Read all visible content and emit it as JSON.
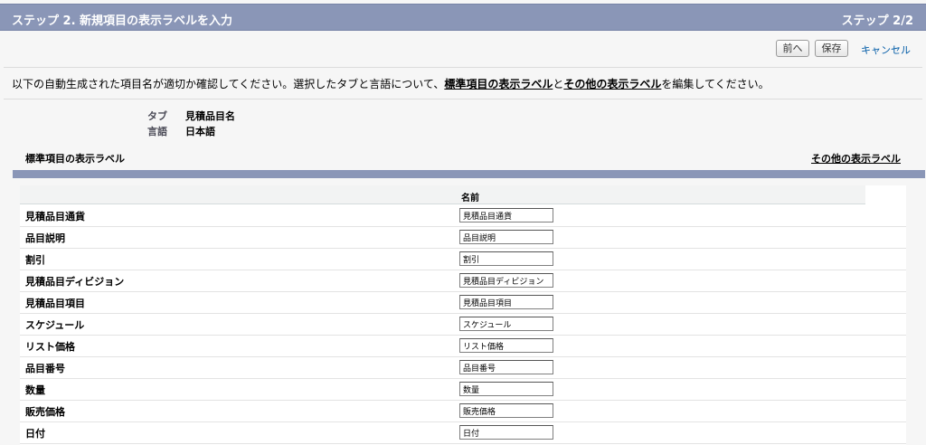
{
  "header": {
    "title": "ステップ 2. 新規項目の表示ラベルを入力",
    "step": "ステップ 2/2"
  },
  "buttons": {
    "prev_label": "前へ",
    "save_label": "保存",
    "cancel_label": "キャンセル"
  },
  "instruction": {
    "part1": "以下の自動生成された項目名が適切か確認してください。選択したタブと言語について、",
    "link1": "標準項目の表示ラベル",
    "part2": "と",
    "link2": "その他の表示ラベル",
    "part3": "を編集してください。"
  },
  "meta": {
    "tab_label": "タブ",
    "tab_value": "見積品目名",
    "lang_label": "言語",
    "lang_value": "日本語"
  },
  "section": {
    "title": "標準項目の表示ラベル",
    "other_link": "その他の表示ラベル"
  },
  "table": {
    "column_header": "名前",
    "rows": [
      {
        "label": "見積品目通貨",
        "value": "見積品目通貨"
      },
      {
        "label": "品目説明",
        "value": "品目説明"
      },
      {
        "label": "割引",
        "value": "割引"
      },
      {
        "label": "見積品目ディビジョン",
        "value": "見積品目ディビジョン"
      },
      {
        "label": "見積品目項目",
        "value": "見積品目項目"
      },
      {
        "label": "スケジュール",
        "value": "スケジュール"
      },
      {
        "label": "リスト価格",
        "value": "リスト価格"
      },
      {
        "label": "品目番号",
        "value": "品目番号"
      },
      {
        "label": "数量",
        "value": "数量"
      },
      {
        "label": "販売価格",
        "value": "販売価格"
      },
      {
        "label": "日付",
        "value": "日付"
      }
    ]
  },
  "colors": {
    "header_bg": "#8a96b7",
    "link": "#015ba7"
  }
}
